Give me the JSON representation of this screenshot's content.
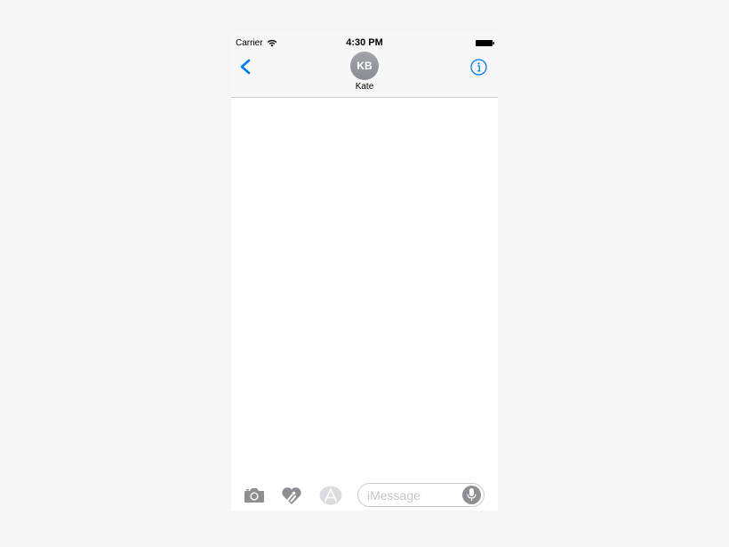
{
  "status_bar": {
    "carrier": "Carrier",
    "time": "4:30 PM",
    "icons": [
      "wifi-icon",
      "battery-icon"
    ]
  },
  "nav_bar": {
    "contact_initials": "KB",
    "contact_name": "Kate",
    "icons": [
      "chevron-left-icon",
      "info-icon"
    ]
  },
  "input_bar": {
    "placeholder": "iMessage",
    "icons": [
      "camera-icon",
      "digital-touch-icon",
      "app-store-icon",
      "microphone-icon"
    ]
  },
  "colors": {
    "accent": "#007aff",
    "icon_gray": "#8e8e93",
    "icon_disabled": "#dcdce0",
    "bar_background": "#f7f7f7"
  }
}
